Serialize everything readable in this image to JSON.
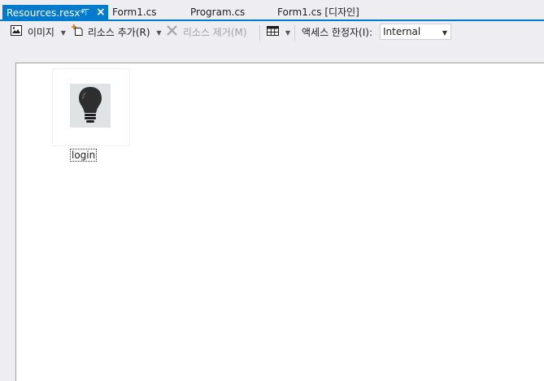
{
  "tabs": [
    {
      "label": "Resources.resx*",
      "active": true
    },
    {
      "label": "Form1.cs",
      "active": false
    },
    {
      "label": "Program.cs",
      "active": false
    },
    {
      "label": "Form1.cs [디자인]",
      "active": false
    }
  ],
  "tab_icons": {
    "pin": "pin-icon",
    "close": "close-icon"
  },
  "toolbar": {
    "images_label": "이미지",
    "add_resource_label": "리소스 추가(R)",
    "remove_resource_label": "리소스 제거(M)",
    "access_modifier_label": "액세스 한정자(I):",
    "access_modifier_value": "Internal"
  },
  "resources": [
    {
      "name": "login",
      "icon": "lightbulb-icon"
    }
  ],
  "colors": {
    "accent": "#007acc",
    "background": "#eeeef2",
    "disabled": "#a2a2a2"
  }
}
